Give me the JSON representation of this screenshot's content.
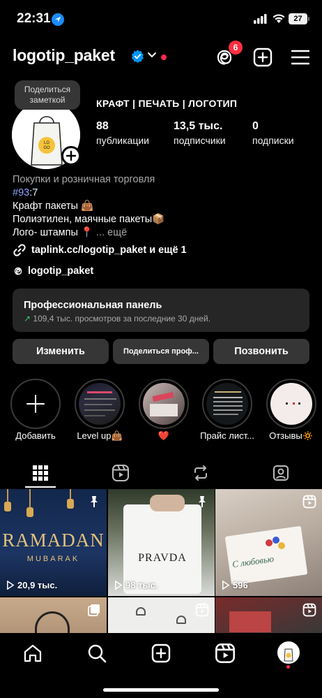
{
  "status_bar": {
    "time": "22:31",
    "battery": "27"
  },
  "header": {
    "username": "logotip_paket",
    "notifications": "6"
  },
  "profile": {
    "note": "Поделиться заметкой",
    "category_line": "КРАФТ | ПЕЧАТЬ | ЛОГОТИП",
    "stats": [
      {
        "num": "88",
        "label": "публикации"
      },
      {
        "num": "13,5 тыс.",
        "label": "подписчики"
      },
      {
        "num": "0",
        "label": "подписки"
      }
    ],
    "bio": {
      "category": "Покупки и розничная торговля",
      "hashtag": "#93",
      "hashtag_rest": ":7",
      "line1": "Крафт пакеты 👜",
      "line2": "Полиэтилен, маячные пакеты📦",
      "line3": "Лого- штампы 📍",
      "more": "... ещё"
    },
    "link": "taplink.cc/logotip_paket и ещё 1",
    "threads": "logotip_paket"
  },
  "dashboard": {
    "title": "Профессиональная панель",
    "arrow": "↗",
    "subtitle": "109,4 тыс. просмотров за последние 30 дней."
  },
  "actions": {
    "edit": "Изменить",
    "share": "Поделиться проф...",
    "call": "Позвонить"
  },
  "highlights": [
    {
      "label": "Добавить"
    },
    {
      "label": "Level up👜"
    },
    {
      "label": "❤️"
    },
    {
      "label": "Прайс лист..."
    },
    {
      "label": "Отзывы🔅"
    }
  ],
  "grid": {
    "posts": [
      {
        "views": "20,9 тыс.",
        "title": "RAMADAN",
        "subtitle": "MUBARAK"
      },
      {
        "views": "98 тыс.",
        "title": "PRAVDA"
      },
      {
        "views": "596",
        "title": "С любовью"
      }
    ]
  },
  "colors": {
    "accent_blue": "#0095f6",
    "badge_red": "#ff3040",
    "card_bg": "#262626",
    "button_bg": "#363636"
  }
}
